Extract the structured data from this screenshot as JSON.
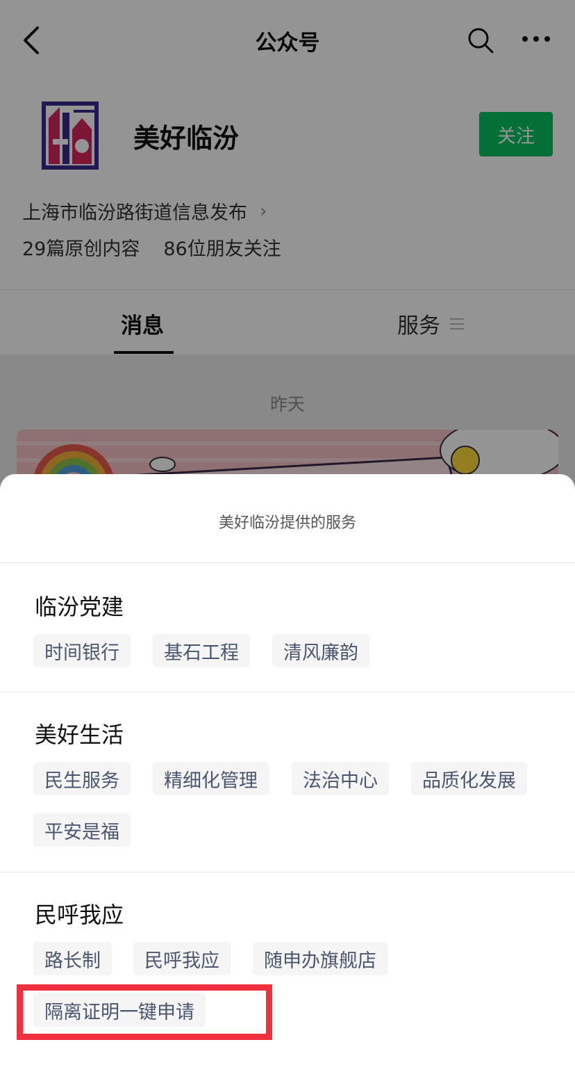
{
  "nav": {
    "title": "公众号"
  },
  "account": {
    "name": "美好临汾",
    "follow_label": "关注",
    "description": "上海市临汾路街道信息发布",
    "original_count": "29篇原创内容",
    "friends_following": "86位朋友关注"
  },
  "tabs": {
    "messages": "消息",
    "services": "服务"
  },
  "feed": {
    "date_label": "昨天"
  },
  "sheet": {
    "title": "美好临汾提供的服务",
    "sections": [
      {
        "title": "临汾党建",
        "items": [
          "时间银行",
          "基石工程",
          "清风廉韵"
        ]
      },
      {
        "title": "美好生活",
        "items": [
          "民生服务",
          "精细化管理",
          "法治中心",
          "品质化发展",
          "平安是福"
        ]
      },
      {
        "title": "民呼我应",
        "items": [
          "路长制",
          "民呼我应",
          "随申办旗舰店",
          "隔离证明一键申请"
        ]
      }
    ]
  },
  "colors": {
    "follow_green": "#07c160",
    "highlight_red": "#f0303f",
    "chip_text": "#4a5570"
  }
}
